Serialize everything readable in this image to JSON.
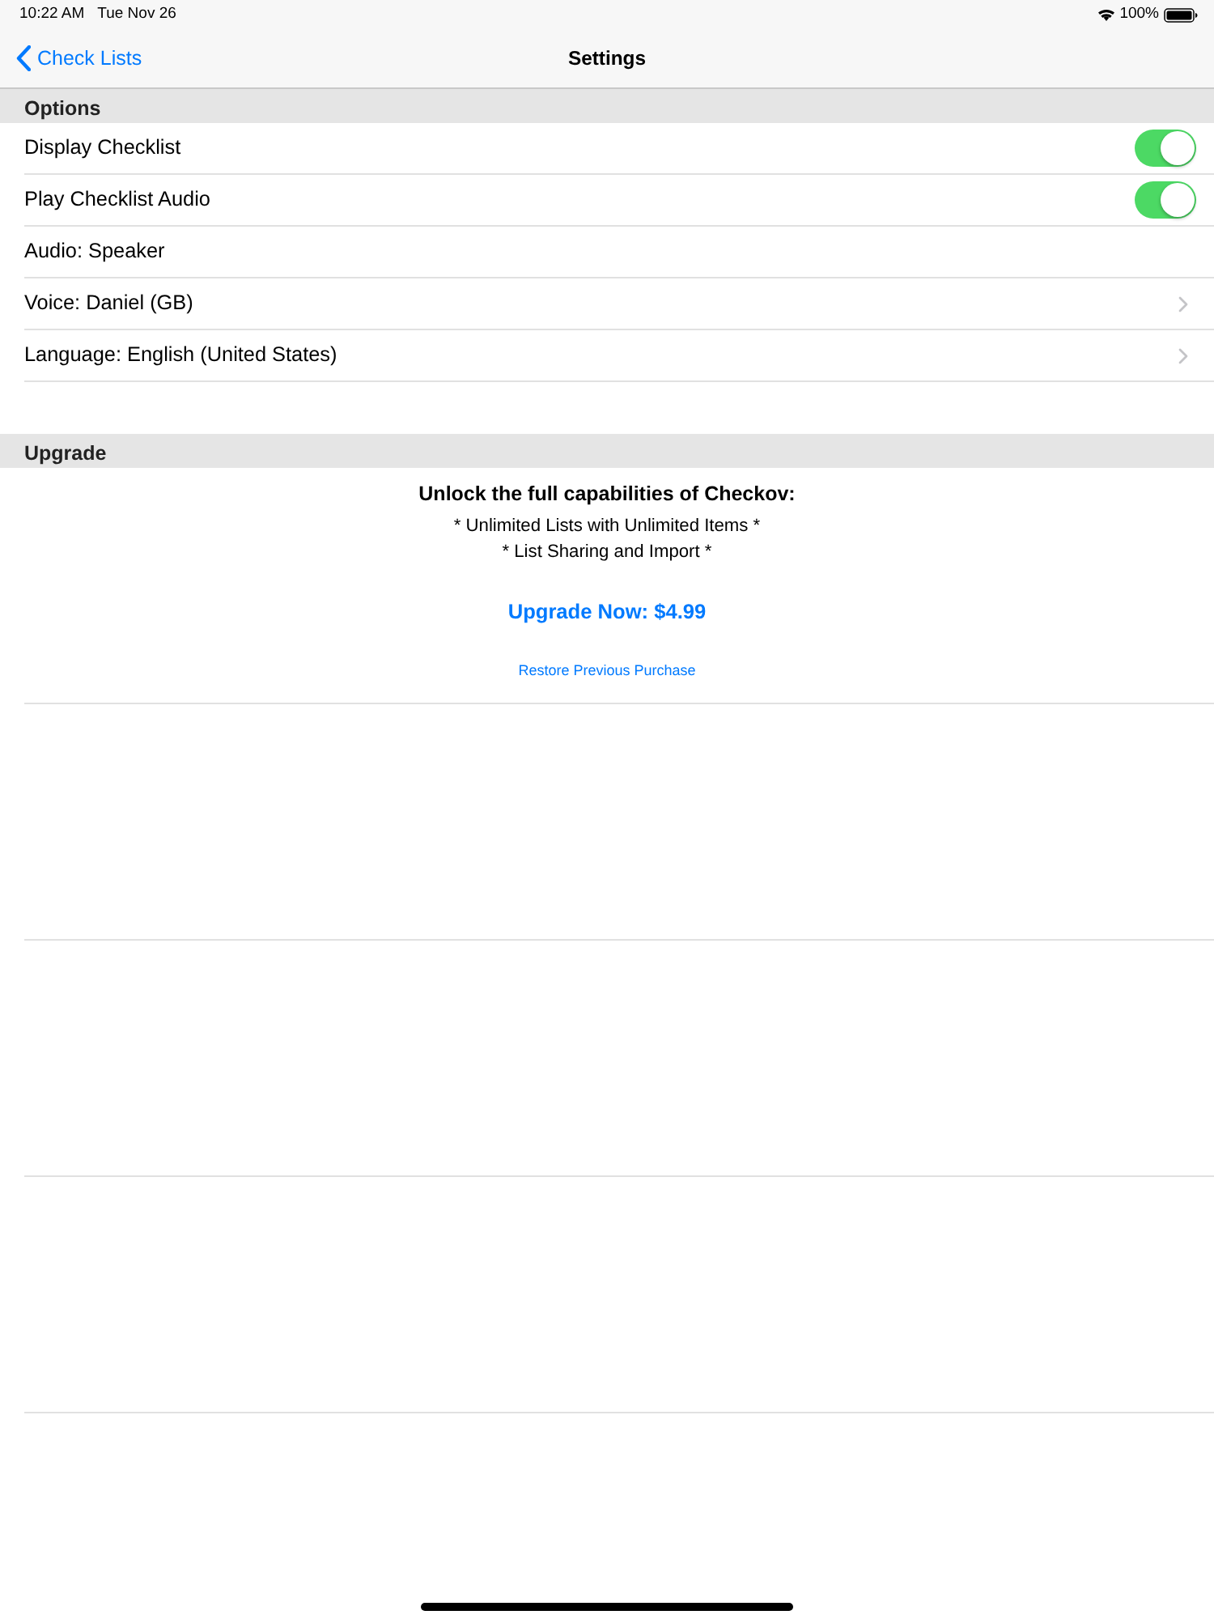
{
  "status_bar": {
    "time": "10:22 AM",
    "date": "Tue Nov 26",
    "battery": "100%"
  },
  "nav": {
    "back": "Check Lists",
    "title": "Settings"
  },
  "options": {
    "title": "Options",
    "rows": [
      {
        "kind": "toggle",
        "label": "Display Checklist",
        "on": true
      },
      {
        "kind": "toggle",
        "label": "Play Checklist Audio",
        "on": true
      },
      {
        "kind": "plain",
        "label": "Audio: Speaker"
      },
      {
        "kind": "disclosure",
        "label": "Voice: Daniel (GB)"
      },
      {
        "kind": "disclosure",
        "label": "Language: English (United States)"
      }
    ]
  },
  "upgrade": {
    "title": "Upgrade",
    "heading": "Unlock the full capabilities of Checkov:",
    "features": [
      "* Unlimited Lists with Unlimited Items *",
      "* List Sharing and Import *"
    ],
    "buy_button": "Upgrade Now: $4.99",
    "restore_link": "Restore Previous Purchase"
  }
}
